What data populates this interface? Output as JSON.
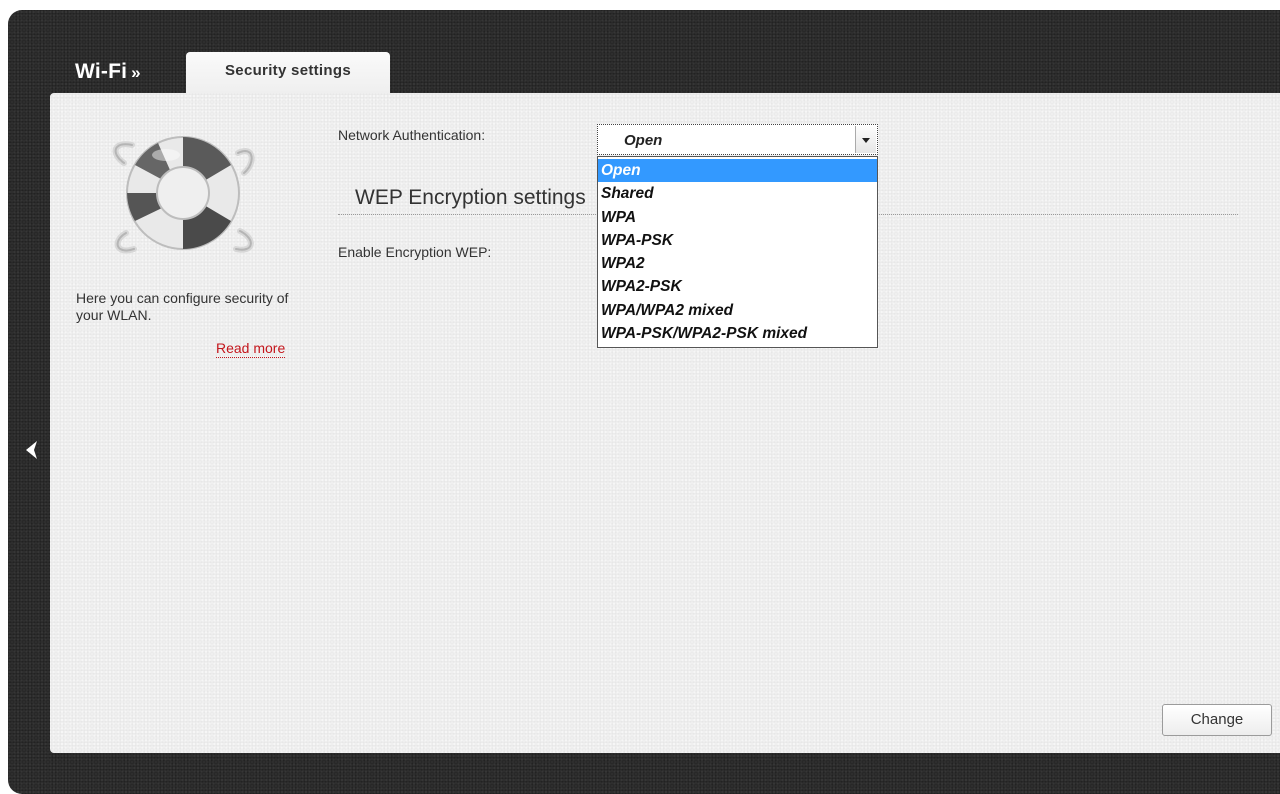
{
  "breadcrumb": {
    "section": "Wi-Fi",
    "separator": "»"
  },
  "tab": {
    "label": "Security settings"
  },
  "sidebar": {
    "icon": "lifebuoy-icon",
    "help_text": "Here you can configure security of your WLAN.",
    "read_more": "Read more"
  },
  "form": {
    "network_auth_label": "Network Authentication:",
    "network_auth_value": "Open",
    "network_auth_options": [
      "Open",
      "Shared",
      "WPA",
      "WPA-PSK",
      "WPA2",
      "WPA2-PSK",
      "WPA/WPA2 mixed",
      "WPA-PSK/WPA2-PSK mixed"
    ],
    "wep_section_title": "WEP Encryption settings",
    "enable_wep_label": "Enable Encryption WEP:"
  },
  "actions": {
    "change_label": "Change"
  },
  "nav": {
    "back_icon": "chevron-left-icon"
  },
  "colors": {
    "frame_bg": "#2e2e2e",
    "panel_bg": "#efefef",
    "link_red": "#c4161c",
    "option_highlight": "#3399ff"
  }
}
